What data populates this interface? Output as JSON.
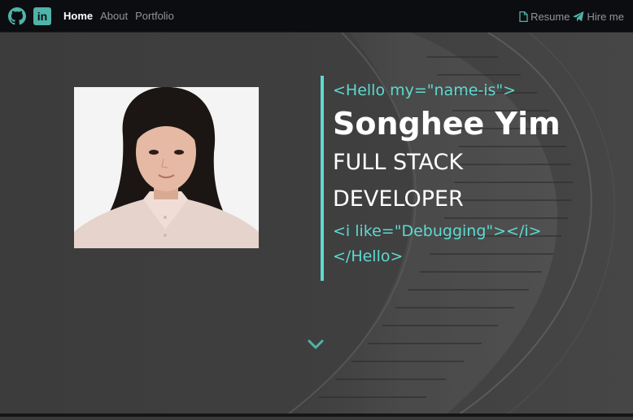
{
  "navbar": {
    "social": [
      {
        "icon": "github-icon"
      },
      {
        "icon": "linkedin-icon",
        "text": "in"
      }
    ],
    "links": [
      {
        "label": "Home",
        "active": true
      },
      {
        "label": "About",
        "active": false
      },
      {
        "label": "Portfolio",
        "active": false
      }
    ],
    "actions": [
      {
        "label": "Resume",
        "icon": "file-icon"
      },
      {
        "label": "Hire me",
        "icon": "paper-plane-icon"
      }
    ]
  },
  "hero": {
    "open_tag": "<Hello my=\"name-is\">",
    "name": "Songhee Yim",
    "role_line1": "FULL STACK",
    "role_line2": "DEVELOPER",
    "like_tag": "<i like=\"Debugging\"></i>",
    "close_tag": "</Hello>",
    "scroll_icon": "chevron-down-icon"
  },
  "colors": {
    "accent": "#5ed9d0",
    "icon_accent": "#4fb3a9",
    "navbar_bg": "#0c0d10",
    "hero_bg": "#3c3c3c"
  }
}
